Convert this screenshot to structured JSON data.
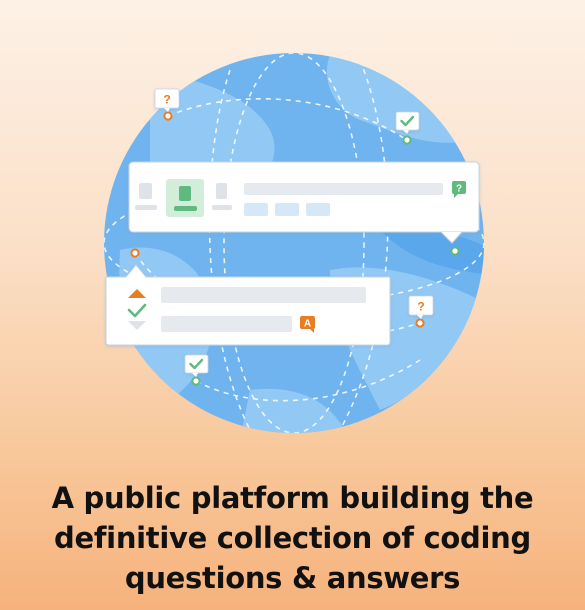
{
  "illustration": {
    "globe_color": "#6fb3ef",
    "card_background": "#ffffff",
    "accent_green": "#5eba7d",
    "accent_orange": "#e87d22",
    "question_badge_symbol": "?",
    "accepted_badge_symbol": "A",
    "icons": [
      "question-bubble-icon",
      "check-bubble-icon",
      "upvote-arrow-icon",
      "accepted-check-icon",
      "downvote-arrow-icon",
      "answer-badge-icon",
      "location-pin-icon"
    ]
  },
  "headline": {
    "line1": "A public platform building the",
    "line2": "definitive collection of coding",
    "line3": "questions & answers"
  }
}
